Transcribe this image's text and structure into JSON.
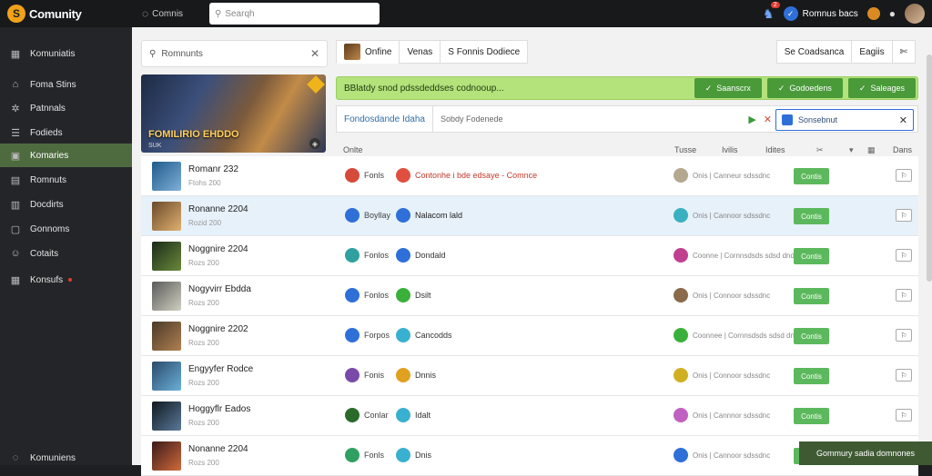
{
  "app": {
    "name": "Comunity",
    "logo_glyph": "S"
  },
  "top_nav": {
    "label": "Comnis"
  },
  "search": {
    "placeholder": "Searqh"
  },
  "top_right": {
    "badge_count": "2",
    "user_label": "Romnus bacs"
  },
  "sidebar": {
    "items": [
      {
        "label": "Komuniatis",
        "icon": "grid-icon",
        "glyph": "▦"
      },
      {
        "label": "Foma Stins",
        "icon": "home-icon",
        "glyph": "⌂"
      },
      {
        "label": "Patnnals",
        "icon": "gear-icon",
        "glyph": "✲"
      },
      {
        "label": "Fodieds",
        "icon": "chat-icon",
        "glyph": "☰"
      },
      {
        "label": "Komaries",
        "icon": "tile-icon",
        "glyph": "▣",
        "active": true
      },
      {
        "label": "Romnuts",
        "icon": "list-icon",
        "glyph": "▤"
      },
      {
        "label": "Docdirts",
        "icon": "document-icon",
        "glyph": "▥"
      },
      {
        "label": "Gonnoms",
        "icon": "monitor-icon",
        "glyph": "▢"
      },
      {
        "label": "Cotaits",
        "icon": "people-icon",
        "glyph": "☺"
      },
      {
        "label": "Konsufs",
        "icon": "folder-icon",
        "glyph": "▦"
      }
    ],
    "footer": {
      "label": "Komuniens",
      "glyph": "◌"
    }
  },
  "left_col": {
    "search_label": "Romnunts",
    "banner_title": "FOMILIRIO EHDDO",
    "banner_sub": "SUK"
  },
  "tabs": [
    {
      "label": "Onfine",
      "active": true
    },
    {
      "label": "Venas"
    },
    {
      "label": "S  Fonnis Dodiece"
    }
  ],
  "tabs_right": [
    {
      "label": "Se Coadsanca"
    },
    {
      "label": "Eagiis"
    },
    {
      "label": "✄"
    }
  ],
  "green_bar": {
    "text": "BBlatdy snod pdssdeddses codnooup...",
    "buttons": [
      "Saanscrx",
      "Godoedens",
      "Saleages"
    ]
  },
  "filter_bar": {
    "left": "Fondosdande Idaha",
    "mid": "Sobdy Fodenede",
    "select": "Sonsebnut"
  },
  "thead": {
    "col1": "Onlte",
    "col2": "Tusse",
    "col3": "Ivilis",
    "col4": "Idites",
    "col5": "Dans"
  },
  "rows": [
    {
      "title": "Romanr 232",
      "sub": "Ftohs 200",
      "c1": "Fonls",
      "c1_color": "#d64a3a",
      "c2": "Contonhe i bde edsaye - Comnce",
      "c2_color": "#c23a2a",
      "c3": "Onis | Canneur sdssdnc",
      "c3_color": "#b4a88f",
      "action": "Contis",
      "flag": "⚐",
      "thumb": "linear-gradient(135deg,#1f5a8a,#7fb0d8)",
      "c2_dot": "#e05040",
      "c1_dot": "#d64a3a"
    },
    {
      "title": "Ronanne 2204",
      "sub": "Rozid 200",
      "c1": "Boyllay",
      "c1_color": "#2f6fd8",
      "c2": "Nalacom lald",
      "c2_color": "#222",
      "c3": "Onis | Cannoor sdssdnc",
      "c3_color": "#3ab0c0",
      "action": "Contis",
      "flag": "⚐",
      "thumb": "linear-gradient(135deg,#6a4a2a,#e0b070)",
      "c2_dot": "#2f6fd8",
      "c1_dot": "#2f6fd8",
      "selected": true
    },
    {
      "title": "Noggnire 2204",
      "sub": "Rozs 200",
      "c1": "Fonlos",
      "c1_color": "#2fa060",
      "c2": "Dondald",
      "c2_color": "#333",
      "c3": "Coonne | Cornnsdsds sdsd dndds",
      "c3_color": "#c04090",
      "action": "Contis",
      "flag": "⚐",
      "thumb": "linear-gradient(135deg,#1a2a1a,#6a8a3a)",
      "c2_dot": "#2f6fd8",
      "c1_dot": "#2fa0a0"
    },
    {
      "title": "Nogyvirr Ebdda",
      "sub": "Rozs 200",
      "c1": "Fonlos",
      "c1_color": "#2f6fd8",
      "c2": "Dsilt",
      "c2_color": "#333",
      "c3": "Onis | Connoor sdssdnc",
      "c3_color": "#8a6a4a",
      "action": "Contis",
      "flag": "⚐",
      "thumb": "linear-gradient(135deg,#5a5a5a,#d0d0c0)",
      "c2_dot": "#3ab03a",
      "c1_dot": "#2f6fd8"
    },
    {
      "title": "Noggnire 2202",
      "sub": "Rozs 200",
      "c1": "Forpos",
      "c1_color": "#2f6fd8",
      "c2": "Cancodds",
      "c2_color": "#333",
      "c3": "Coonnee | Cornnsdsds sdsd dndds",
      "c3_color": "#3ab03a",
      "action": "Contis",
      "flag": "⚐",
      "thumb": "linear-gradient(135deg,#4a3a2a,#b08050)",
      "c2_dot": "#3ab0d0",
      "c1_dot": "#2f6fd8"
    },
    {
      "title": "Engyyfer Rodce",
      "sub": "Rozs 200",
      "c1": "Fonis",
      "c1_color": "#7a4aaa",
      "c2": "Dnnis",
      "c2_color": "#333",
      "c3": "Onis | Connoor sdssdnc",
      "c3_color": "#d0b020",
      "action": "Contis",
      "flag": "⚐",
      "thumb": "linear-gradient(135deg,#2a4a6a,#6ab0d8)",
      "c2_dot": "#e0a020",
      "c1_dot": "#7a4aaa"
    },
    {
      "title": "Hoggyflr Eados",
      "sub": "Rozs 200",
      "c1": "Conlar",
      "c1_color": "#2fa060",
      "c2": "Idalt",
      "c2_color": "#333",
      "c3": "Onis | Cannnor sdssdnc",
      "c3_color": "#c060c0",
      "action": "Contis",
      "flag": "⚐",
      "thumb": "linear-gradient(135deg,#101820,#5a7a9a)",
      "c2_dot": "#3ab0d0",
      "c1_dot": "#2a6a2a"
    },
    {
      "title": "Nonanne 2204",
      "sub": "Rozs 200",
      "c1": "Fonls",
      "c1_color": "#2fa060",
      "c2": "Dnis",
      "c2_color": "#333",
      "c3": "Onis | Cannoor sdssdnc",
      "c3_color": "#2f6fd8",
      "action": "Contis",
      "flag": "⚐",
      "thumb": "linear-gradient(135deg,#3a1a1a,#d06a3a)",
      "c2_dot": "#3ab0d0",
      "c1_dot": "#2fa060"
    }
  ],
  "toast": {
    "text": "Gommury sadia domnones"
  },
  "colors": {
    "accent": "#4e6b3f",
    "green": "#5cb85c",
    "blue": "#2f6fd8"
  }
}
